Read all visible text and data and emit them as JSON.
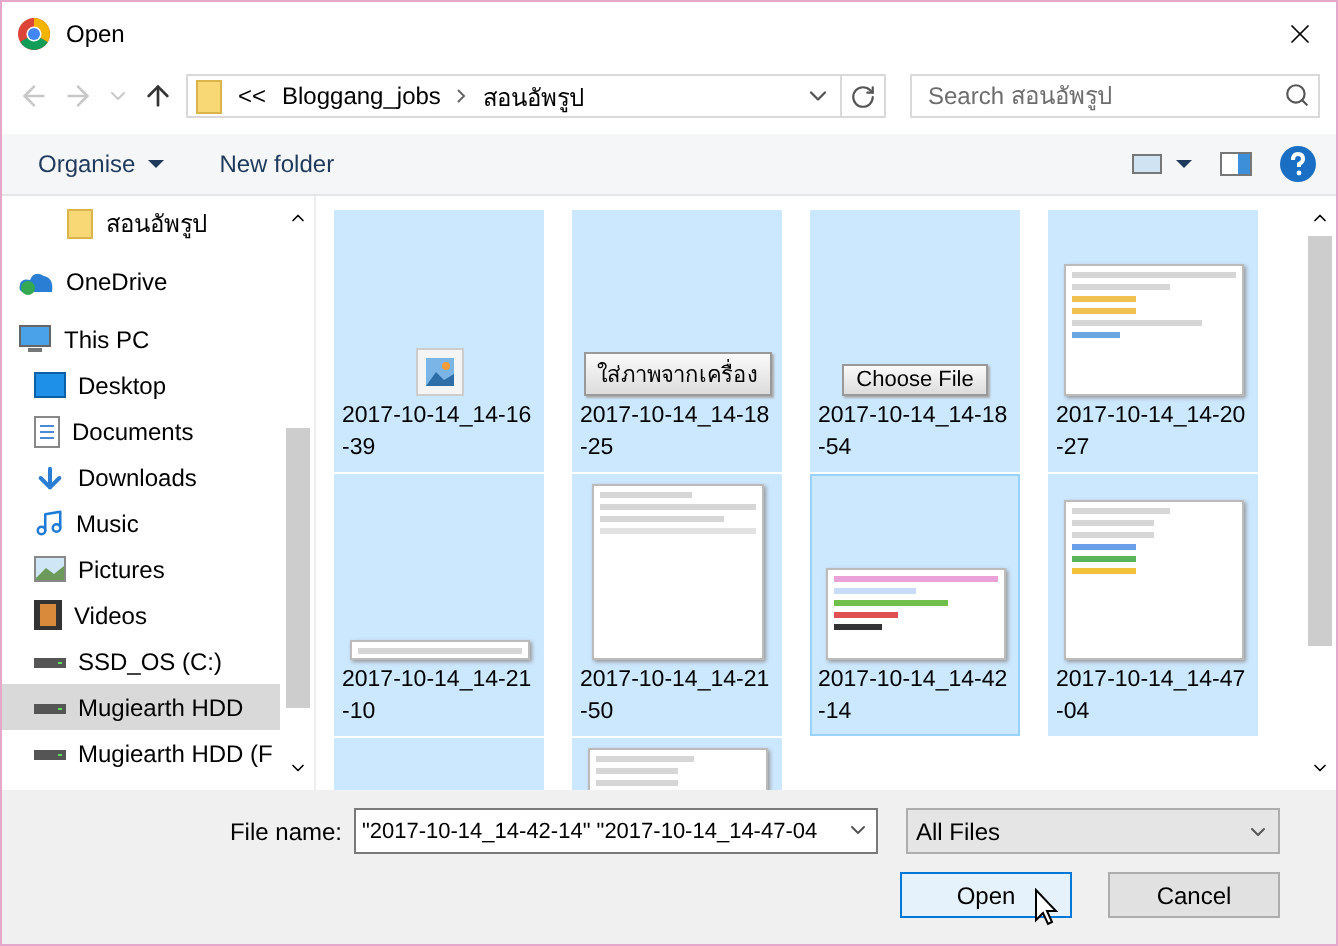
{
  "window": {
    "title": "Open"
  },
  "nav": {
    "back_disabled": true,
    "forward_disabled": true,
    "overflow": "<<",
    "path": [
      "Bloggang_jobs",
      "สอนอัพรูป"
    ],
    "search": {
      "placeholder": "Search สอนอัพรูป"
    }
  },
  "toolbar": {
    "organise": "Organise",
    "new_folder": "New folder"
  },
  "sidebar": {
    "partial_children": [
      {
        "label": "สอนอัพรูป",
        "kind": "folder",
        "selected": false
      }
    ],
    "items": [
      {
        "label": "OneDrive",
        "kind": "cloud",
        "selected": false
      },
      {
        "label": "This PC",
        "kind": "pc",
        "selected": false,
        "children": [
          {
            "label": "Desktop",
            "kind": "desktop",
            "selected": false
          },
          {
            "label": "Documents",
            "kind": "document",
            "selected": false
          },
          {
            "label": "Downloads",
            "kind": "download",
            "selected": false
          },
          {
            "label": "Music",
            "kind": "music",
            "selected": false
          },
          {
            "label": "Pictures",
            "kind": "pictures",
            "selected": false
          },
          {
            "label": "Videos",
            "kind": "videos",
            "selected": false
          },
          {
            "label": "SSD_OS (C:)",
            "kind": "drive",
            "selected": false
          },
          {
            "label": "Mugiearth HDD",
            "kind": "drive",
            "selected": true
          },
          {
            "label": "Mugiearth HDD (F",
            "kind": "drive",
            "selected": false
          }
        ]
      }
    ]
  },
  "files": [
    {
      "name": "2017-10-14_14-16-39",
      "kind": "image",
      "selected": true,
      "focused": false
    },
    {
      "name": "2017-10-14_14-18-25",
      "kind": "button",
      "caption": "ใส่ภาพจากเครื่อง",
      "selected": true,
      "focused": false
    },
    {
      "name": "2017-10-14_14-18-54",
      "kind": "button",
      "caption": "Choose File",
      "selected": true,
      "focused": false
    },
    {
      "name": "2017-10-14_14-20-27",
      "kind": "dialog",
      "selected": true,
      "focused": false
    },
    {
      "name": "2017-10-14_14-21-10",
      "kind": "strip",
      "selected": true,
      "focused": false
    },
    {
      "name": "2017-10-14_14-21-50",
      "kind": "form",
      "selected": true,
      "focused": false
    },
    {
      "name": "2017-10-14_14-42-14",
      "kind": "browser",
      "selected": true,
      "focused": true
    },
    {
      "name": "2017-10-14_14-47-04",
      "kind": "menu",
      "selected": true,
      "focused": false
    }
  ],
  "more_files": [
    {
      "kind": "blank",
      "selected": true
    },
    {
      "kind": "menu",
      "selected": true
    }
  ],
  "footer": {
    "file_name_label": "File name:",
    "file_name": "\"2017-10-14_14-42-14\" \"2017-10-14_14-47-04",
    "file_type": "All Files",
    "buttons": [
      {
        "label": "Open",
        "default": true
      },
      {
        "label": "Cancel",
        "default": false
      }
    ]
  }
}
